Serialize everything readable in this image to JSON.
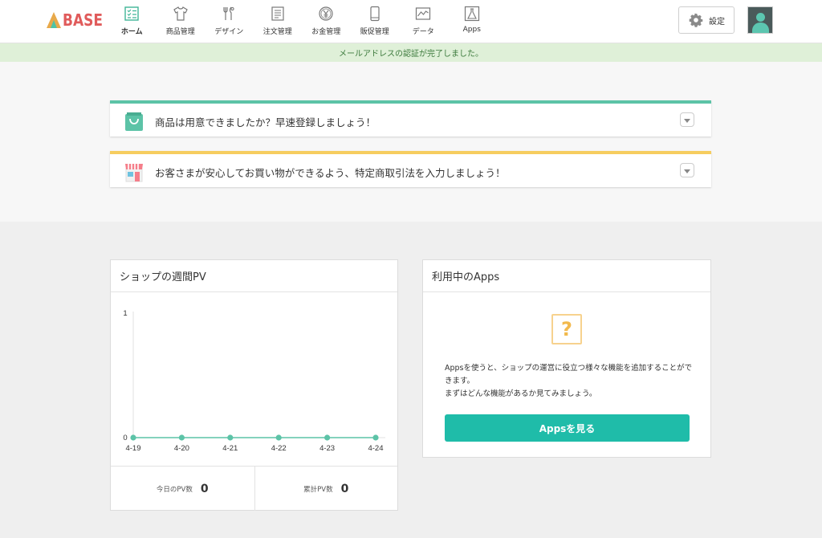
{
  "header": {
    "logo_text": "BASE",
    "nav": [
      {
        "label": "ホーム",
        "icon": "home-checklist-icon",
        "active": true
      },
      {
        "label": "商品管理",
        "icon": "tshirt-icon"
      },
      {
        "label": "デザイン",
        "icon": "brush-tools-icon"
      },
      {
        "label": "注文管理",
        "icon": "order-document-icon"
      },
      {
        "label": "お金管理",
        "icon": "yen-coin-icon"
      },
      {
        "label": "販促管理",
        "icon": "smartphone-icon"
      },
      {
        "label": "データ",
        "icon": "line-chart-icon"
      },
      {
        "label": "Apps",
        "icon": "apps-flask-icon"
      }
    ],
    "settings_label": "設定",
    "settings_icon": "gear-icon",
    "avatar_icon": "user-avatar-icon"
  },
  "notice": {
    "text": "メールアドレスの認証が完了しました。"
  },
  "tasks": [
    {
      "text": "商品は用意できましたか？早速登録しましょう！",
      "icon": "shopping-bag-icon",
      "accent": "#5cc3a7"
    },
    {
      "text": "お客さまが安心してお買い物ができるよう、特定商取引法を入力しましょう！",
      "icon": "storefront-icon",
      "accent": "#f6cd5f"
    }
  ],
  "pv_card": {
    "title": "ショップの週間PV",
    "today_label": "今日のPV数",
    "today_value": "0",
    "total_label": "累計PV数",
    "total_value": "0"
  },
  "chart_data": {
    "type": "line",
    "categories": [
      "4-19",
      "4-20",
      "4-21",
      "4-22",
      "4-23",
      "4-24"
    ],
    "series": [
      {
        "values": [
          0,
          0,
          0,
          0,
          0,
          0
        ]
      }
    ],
    "ylim": [
      0,
      1
    ],
    "yticks": [
      "0",
      "1"
    ],
    "color": "#5cc3a7",
    "grid": false
  },
  "apps_card": {
    "title": "利用中のApps",
    "icon_glyph": "?",
    "description": "Appsを使うと、ショップの運営に役立つ様々な機能を追加することができます。\nまずはどんな機能があるか見てみましょう。",
    "button_label": "Appsを見る"
  }
}
